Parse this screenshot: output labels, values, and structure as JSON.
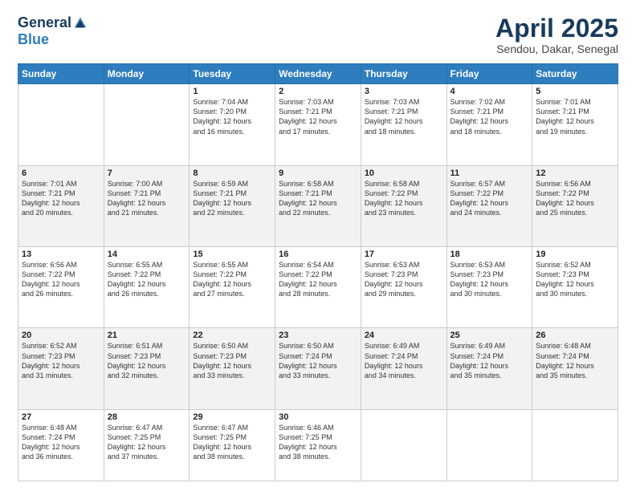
{
  "logo": {
    "general": "General",
    "blue": "Blue"
  },
  "title": {
    "month": "April 2025",
    "location": "Sendou, Dakar, Senegal"
  },
  "weekdays": [
    "Sunday",
    "Monday",
    "Tuesday",
    "Wednesday",
    "Thursday",
    "Friday",
    "Saturday"
  ],
  "weeks": [
    [
      {
        "day": "",
        "info": ""
      },
      {
        "day": "",
        "info": ""
      },
      {
        "day": "1",
        "info": "Sunrise: 7:04 AM\nSunset: 7:20 PM\nDaylight: 12 hours\nand 16 minutes."
      },
      {
        "day": "2",
        "info": "Sunrise: 7:03 AM\nSunset: 7:21 PM\nDaylight: 12 hours\nand 17 minutes."
      },
      {
        "day": "3",
        "info": "Sunrise: 7:03 AM\nSunset: 7:21 PM\nDaylight: 12 hours\nand 18 minutes."
      },
      {
        "day": "4",
        "info": "Sunrise: 7:02 AM\nSunset: 7:21 PM\nDaylight: 12 hours\nand 18 minutes."
      },
      {
        "day": "5",
        "info": "Sunrise: 7:01 AM\nSunset: 7:21 PM\nDaylight: 12 hours\nand 19 minutes."
      }
    ],
    [
      {
        "day": "6",
        "info": "Sunrise: 7:01 AM\nSunset: 7:21 PM\nDaylight: 12 hours\nand 20 minutes."
      },
      {
        "day": "7",
        "info": "Sunrise: 7:00 AM\nSunset: 7:21 PM\nDaylight: 12 hours\nand 21 minutes."
      },
      {
        "day": "8",
        "info": "Sunrise: 6:59 AM\nSunset: 7:21 PM\nDaylight: 12 hours\nand 22 minutes."
      },
      {
        "day": "9",
        "info": "Sunrise: 6:58 AM\nSunset: 7:21 PM\nDaylight: 12 hours\nand 22 minutes."
      },
      {
        "day": "10",
        "info": "Sunrise: 6:58 AM\nSunset: 7:22 PM\nDaylight: 12 hours\nand 23 minutes."
      },
      {
        "day": "11",
        "info": "Sunrise: 6:57 AM\nSunset: 7:22 PM\nDaylight: 12 hours\nand 24 minutes."
      },
      {
        "day": "12",
        "info": "Sunrise: 6:56 AM\nSunset: 7:22 PM\nDaylight: 12 hours\nand 25 minutes."
      }
    ],
    [
      {
        "day": "13",
        "info": "Sunrise: 6:56 AM\nSunset: 7:22 PM\nDaylight: 12 hours\nand 26 minutes."
      },
      {
        "day": "14",
        "info": "Sunrise: 6:55 AM\nSunset: 7:22 PM\nDaylight: 12 hours\nand 26 minutes."
      },
      {
        "day": "15",
        "info": "Sunrise: 6:55 AM\nSunset: 7:22 PM\nDaylight: 12 hours\nand 27 minutes."
      },
      {
        "day": "16",
        "info": "Sunrise: 6:54 AM\nSunset: 7:22 PM\nDaylight: 12 hours\nand 28 minutes."
      },
      {
        "day": "17",
        "info": "Sunrise: 6:53 AM\nSunset: 7:23 PM\nDaylight: 12 hours\nand 29 minutes."
      },
      {
        "day": "18",
        "info": "Sunrise: 6:53 AM\nSunset: 7:23 PM\nDaylight: 12 hours\nand 30 minutes."
      },
      {
        "day": "19",
        "info": "Sunrise: 6:52 AM\nSunset: 7:23 PM\nDaylight: 12 hours\nand 30 minutes."
      }
    ],
    [
      {
        "day": "20",
        "info": "Sunrise: 6:52 AM\nSunset: 7:23 PM\nDaylight: 12 hours\nand 31 minutes."
      },
      {
        "day": "21",
        "info": "Sunrise: 6:51 AM\nSunset: 7:23 PM\nDaylight: 12 hours\nand 32 minutes."
      },
      {
        "day": "22",
        "info": "Sunrise: 6:50 AM\nSunset: 7:23 PM\nDaylight: 12 hours\nand 33 minutes."
      },
      {
        "day": "23",
        "info": "Sunrise: 6:50 AM\nSunset: 7:24 PM\nDaylight: 12 hours\nand 33 minutes."
      },
      {
        "day": "24",
        "info": "Sunrise: 6:49 AM\nSunset: 7:24 PM\nDaylight: 12 hours\nand 34 minutes."
      },
      {
        "day": "25",
        "info": "Sunrise: 6:49 AM\nSunset: 7:24 PM\nDaylight: 12 hours\nand 35 minutes."
      },
      {
        "day": "26",
        "info": "Sunrise: 6:48 AM\nSunset: 7:24 PM\nDaylight: 12 hours\nand 35 minutes."
      }
    ],
    [
      {
        "day": "27",
        "info": "Sunrise: 6:48 AM\nSunset: 7:24 PM\nDaylight: 12 hours\nand 36 minutes."
      },
      {
        "day": "28",
        "info": "Sunrise: 6:47 AM\nSunset: 7:25 PM\nDaylight: 12 hours\nand 37 minutes."
      },
      {
        "day": "29",
        "info": "Sunrise: 6:47 AM\nSunset: 7:25 PM\nDaylight: 12 hours\nand 38 minutes."
      },
      {
        "day": "30",
        "info": "Sunrise: 6:46 AM\nSunset: 7:25 PM\nDaylight: 12 hours\nand 38 minutes."
      },
      {
        "day": "",
        "info": ""
      },
      {
        "day": "",
        "info": ""
      },
      {
        "day": "",
        "info": ""
      }
    ]
  ]
}
